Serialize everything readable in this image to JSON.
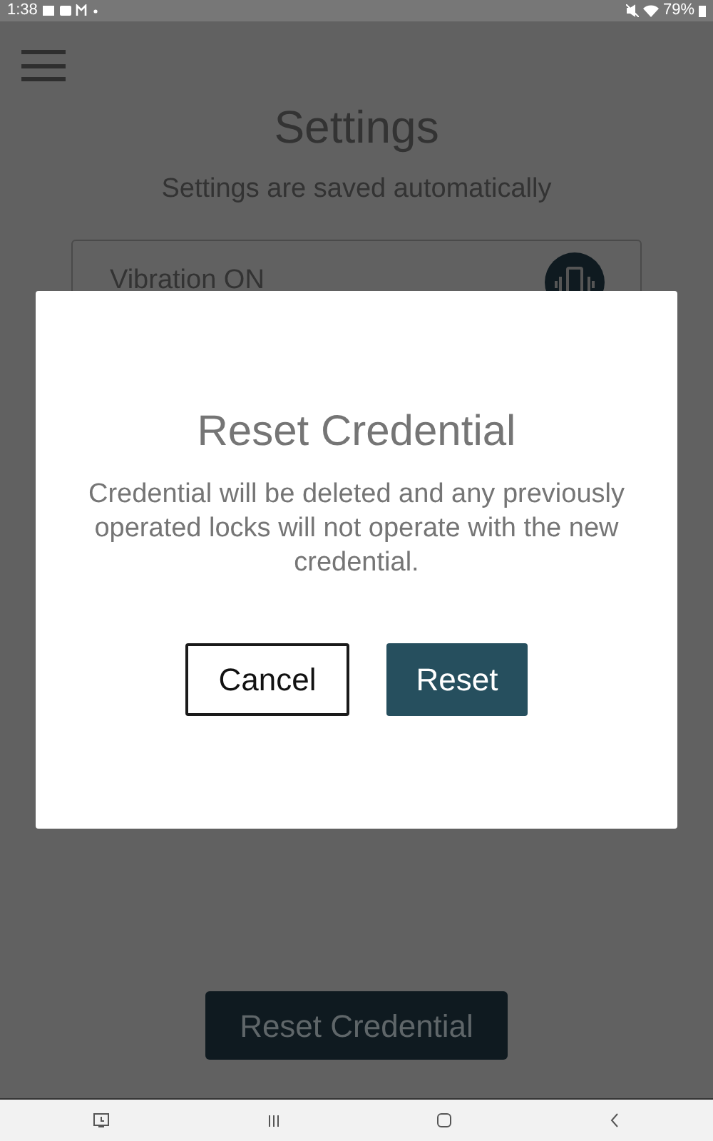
{
  "status_bar": {
    "time": "1:38",
    "battery": "79%"
  },
  "screen": {
    "title": "Settings",
    "subtitle": "Settings are saved automatically",
    "setting": {
      "label": "Vibration ON"
    },
    "reset_button": "Reset Credential"
  },
  "dialog": {
    "title": "Reset Credential",
    "message": "Credential will be deleted and any previously operated locks will not operate with the new credential.",
    "buttons": [
      {
        "label": "Cancel",
        "kind": "secondary"
      },
      {
        "label": "Reset",
        "kind": "primary"
      }
    ]
  }
}
